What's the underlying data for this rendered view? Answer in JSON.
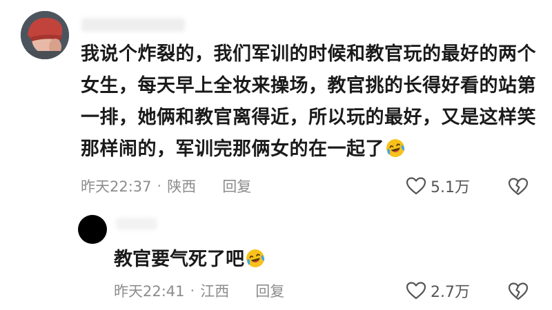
{
  "comment": {
    "text": "我说个炸裂的，我们军训的时候和教官玩的最好的两个女生，每天早上全妆来操场，教官挑的长得好看的站第一排，她俩和教官离得近，所以玩的最好，又是这样笑那样闹的，军训完那俩女的在一起了",
    "emoji": "laughing-crying-emoji",
    "time": "昨天22:37",
    "separator": "·",
    "location": "陕西",
    "reply_label": "回复",
    "like_count": "5.1万"
  },
  "reply": {
    "text": "教官要气死了吧",
    "emoji": "laughing-crying-emoji",
    "time": "昨天22:41",
    "separator": "·",
    "location": "江西",
    "reply_label": "回复",
    "like_count": "2.7万"
  },
  "colors": {
    "text": "#1a1a1a",
    "meta": "#8c8c8c",
    "icon": "#555555",
    "emoji_face": "#f7c21b"
  }
}
